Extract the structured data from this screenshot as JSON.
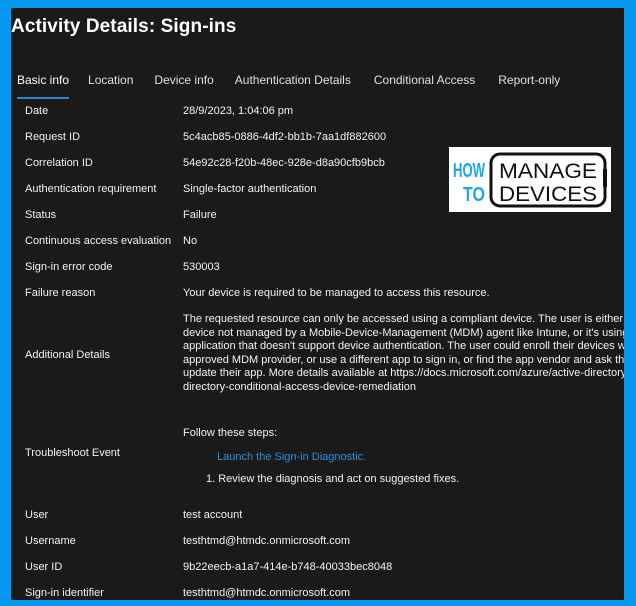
{
  "window": {
    "title": "Activity Details: Sign-ins",
    "frame_color": "#0798f2",
    "background_color": "#1b1a19"
  },
  "tabs": [
    {
      "label": "Basic info",
      "active": true
    },
    {
      "label": "Location",
      "active": false
    },
    {
      "label": "Device info",
      "active": false
    },
    {
      "label": "Authentication Details",
      "active": false
    },
    {
      "label": "Conditional Access",
      "active": false
    },
    {
      "label": "Report-only",
      "active": false
    }
  ],
  "fields": {
    "date": {
      "label": "Date",
      "value": "28/9/2023, 1:04:06 pm"
    },
    "request_id": {
      "label": "Request ID",
      "value": "5c4acb85-0886-4df2-bb1b-7aa1df882600"
    },
    "correlation_id": {
      "label": "Correlation ID",
      "value": "54e92c28-f20b-48ec-928e-d8a90cfb9bcb"
    },
    "auth_requirement": {
      "label": "Authentication requirement",
      "value": "Single-factor authentication"
    },
    "status": {
      "label": "Status",
      "value": "Failure"
    },
    "cae": {
      "label": "Continuous access evaluation",
      "value": "No"
    },
    "error_code": {
      "label": "Sign-in error code",
      "value": "530003"
    },
    "failure_reason": {
      "label": "Failure reason",
      "value": "Your device is required to be managed to access this resource."
    },
    "additional_details": {
      "label": "Additional Details",
      "lines": [
        "The requested resource can only be accessed using a compliant device. The user is either using a",
        "device not managed by a Mobile-Device-Management (MDM) agent like Intune, or it's using an",
        "application that doesn't support device authentication. The user could enroll their devices with an",
        "approved MDM provider, or use a different app to sign in, or find the app vendor and ask them to",
        "update their app. More details available at https://docs.microsoft.com/azure/active-directory/active-",
        "directory-conditional-access-device-remediation"
      ]
    },
    "troubleshoot": {
      "label": "Troubleshoot Event",
      "steps_title": "Follow these steps:",
      "link": "Launch the Sign-in Diagnostic.",
      "step_1": "1. Review the diagnosis and act on suggested fixes."
    },
    "user": {
      "label": "User",
      "value": "test account"
    },
    "username": {
      "label": "Username",
      "value": "testhtmd@htmdc.onmicrosoft.com"
    },
    "user_id": {
      "label": "User ID",
      "value": "9b22eecb-a1a7-414e-b748-40033bec8048"
    },
    "signin_identifier": {
      "label": "Sign-in identifier",
      "value": "testhtmd@htmdc.onmicrosoft.com"
    }
  },
  "watermark": {
    "line1_left": "HOW",
    "line2_left": "TO",
    "line1_right": "MANAGE",
    "line2_right": "DEVICES",
    "accent_color": "#1ba7e8"
  },
  "link_color": "#2b8fe0"
}
